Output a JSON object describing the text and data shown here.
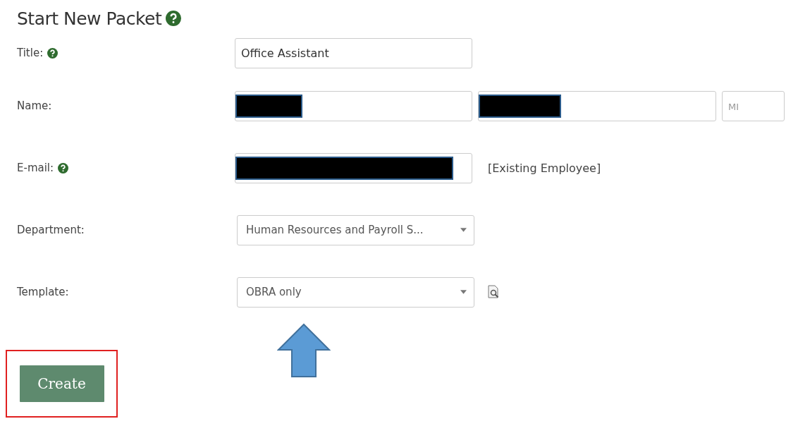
{
  "heading": {
    "text": "Start New Packet",
    "help": true
  },
  "fields": [
    {
      "label": "Title:",
      "help": true,
      "kind": "text",
      "inputs": [
        {
          "value": "Office Assistant",
          "redacted": false
        }
      ]
    },
    {
      "label": "Name:",
      "help": false,
      "kind": "text",
      "inputs": [
        {
          "redacted": true
        },
        {
          "redacted": true
        },
        {
          "placeholder": "MI",
          "redacted": false
        }
      ]
    },
    {
      "label": "E-mail:",
      "help": true,
      "kind": "text",
      "inputs": [
        {
          "redacted": true
        }
      ],
      "note": "[Existing Employee]"
    },
    {
      "label": "Department:",
      "help": false,
      "kind": "select",
      "value": "Human Resources and Payroll S...",
      "preview": false
    },
    {
      "label": "Template:",
      "help": false,
      "kind": "select",
      "value": "OBRA only",
      "preview": true
    }
  ],
  "create_button": {
    "label": "Create",
    "highlighted": true
  },
  "annotation_arrow": true
}
